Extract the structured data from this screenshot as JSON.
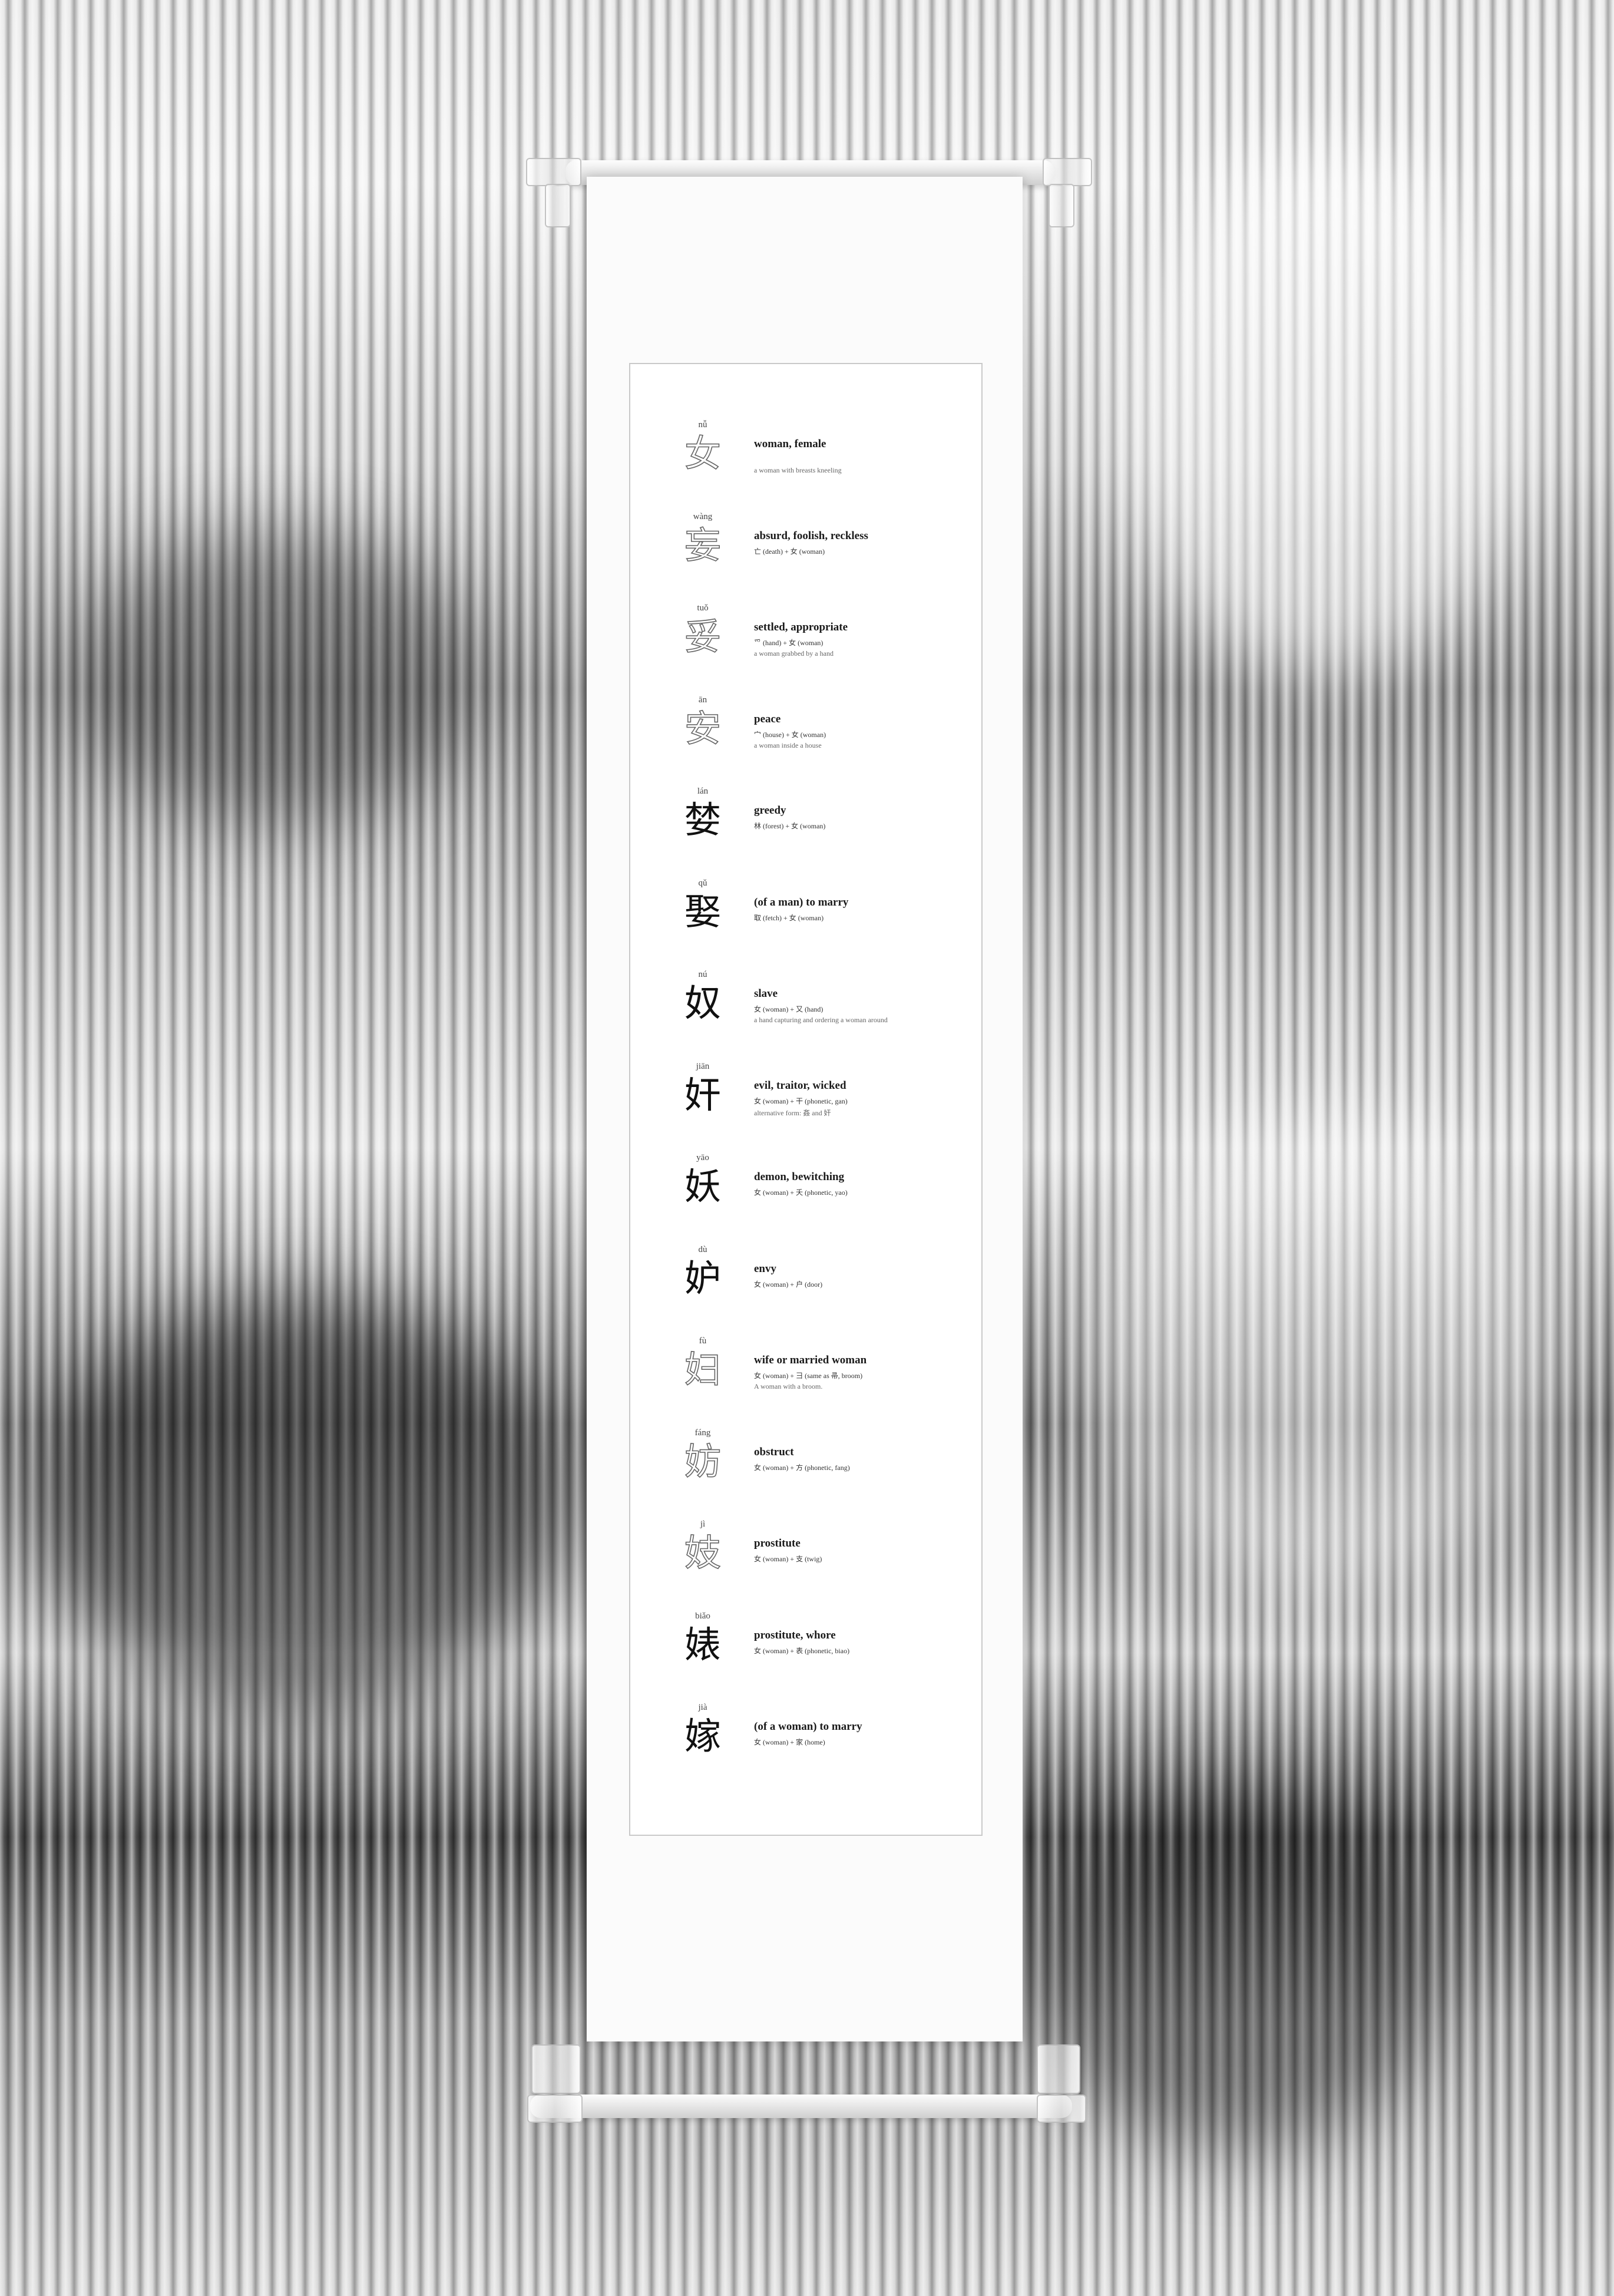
{
  "entries": [
    {
      "pinyin": "nǚ",
      "hanzi": "女",
      "meaning": "woman, female",
      "formula": "",
      "note": "a woman with breasts kneeling"
    },
    {
      "pinyin": "wàng",
      "hanzi": "妄",
      "meaning": "absurd, foolish, reckless",
      "formula": "亡 (death) + 女 (woman)",
      "note": ""
    },
    {
      "pinyin": "tuǒ",
      "hanzi": "妥",
      "meaning": "settled, appropriate",
      "formula": "爫 (hand) + 女 (woman)",
      "note": "a woman grabbed by a hand"
    },
    {
      "pinyin": "ān",
      "hanzi": "安",
      "meaning": "peace",
      "formula": "宀 (house) + 女 (woman)",
      "note": "a woman inside a house"
    },
    {
      "pinyin": "lán",
      "hanzi": "婪",
      "meaning": "greedy",
      "formula": "林 (forest) + 女 (woman)",
      "note": ""
    },
    {
      "pinyin": "qǔ",
      "hanzi": "娶",
      "meaning": "(of a man) to marry",
      "formula": "取 (fetch) + 女 (woman)",
      "note": ""
    },
    {
      "pinyin": "nú",
      "hanzi": "奴",
      "meaning": "slave",
      "formula": "女 (woman) + 又 (hand)",
      "note": "a hand capturing and ordering a woman around"
    },
    {
      "pinyin": "jiān",
      "hanzi": "奸",
      "meaning": "evil, traitor, wicked",
      "formula": "女 (woman) + 干 (phonetic, gan)",
      "note": "alternative form: 姦 and 奸"
    },
    {
      "pinyin": "yāo",
      "hanzi": "妖",
      "meaning": "demon, bewitching",
      "formula": "女 (woman) + 夭 (phonetic, yao)",
      "note": ""
    },
    {
      "pinyin": "dù",
      "hanzi": "妒",
      "meaning": "envy",
      "formula": "女 (woman) + 户 (door)",
      "note": ""
    },
    {
      "pinyin": "fù",
      "hanzi": "妇",
      "meaning": "wife or married woman",
      "formula": "女 (woman) + 彐 (same as 帚, broom)",
      "note": "A woman with a broom."
    },
    {
      "pinyin": "fáng",
      "hanzi": "妨",
      "meaning": "obstruct",
      "formula": "女 (woman) + 方 (phonetic, fang)",
      "note": ""
    },
    {
      "pinyin": "jì",
      "hanzi": "妓",
      "meaning": "prostitute",
      "formula": "女 (woman) + 支 (twig)",
      "note": ""
    },
    {
      "pinyin": "biǎo",
      "hanzi": "婊",
      "meaning": "prostitute, whore",
      "formula": "女 (woman) + 表 (phonetic, biao)",
      "note": ""
    },
    {
      "pinyin": "jià",
      "hanzi": "嫁",
      "meaning": "(of a woman) to marry",
      "formula": "女 (woman) + 家 (home)",
      "note": ""
    }
  ]
}
